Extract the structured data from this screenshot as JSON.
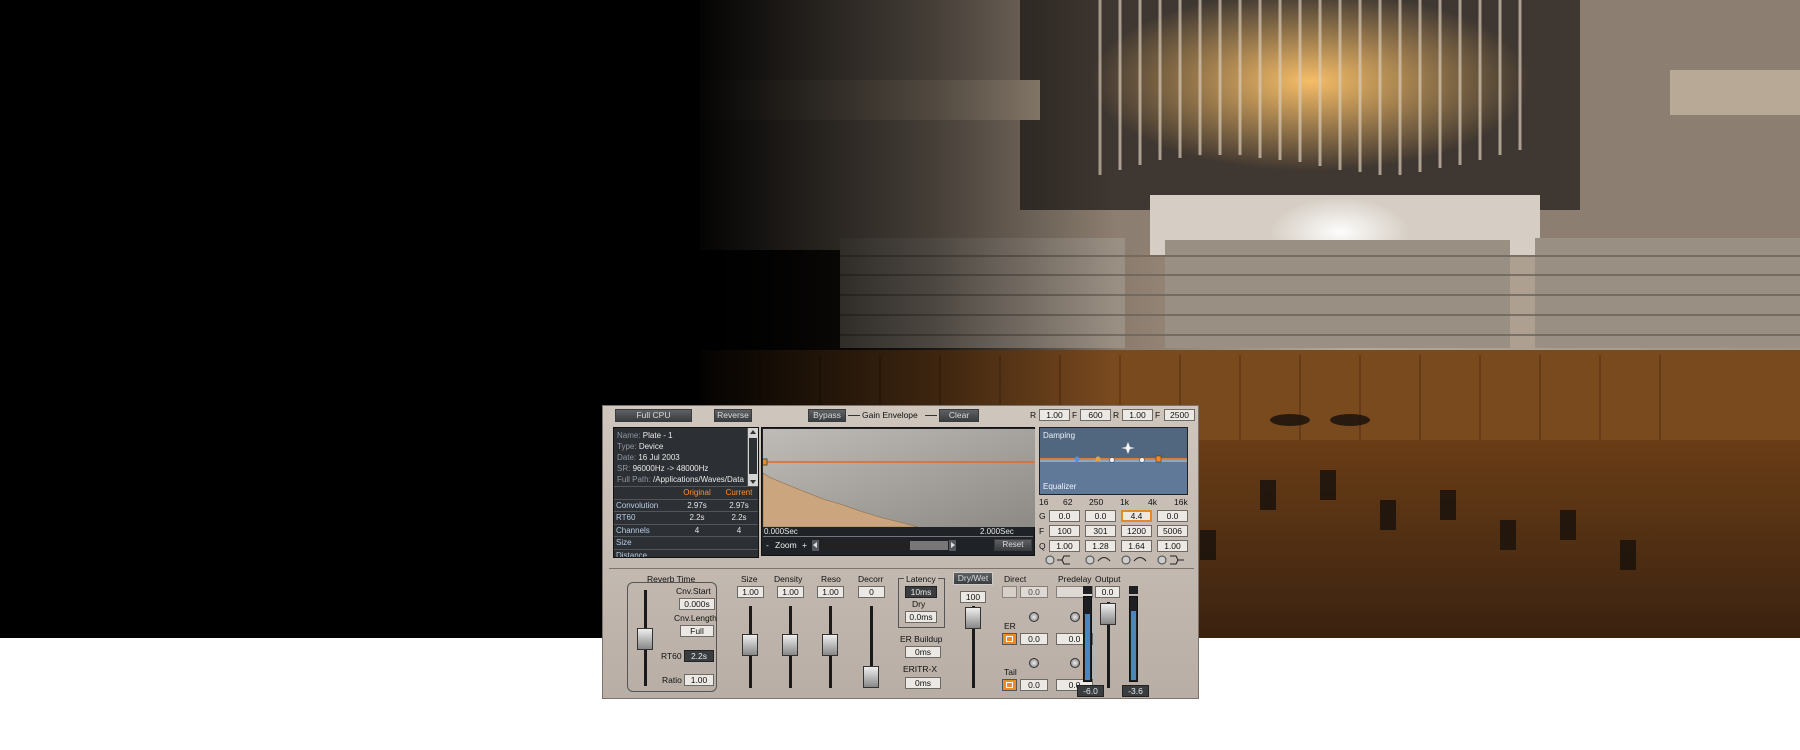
{
  "plugin": {
    "top_bar": {
      "full_cpu": "Full CPU",
      "reverse": "Reverse",
      "bypass": "Bypass",
      "gain_envelope": "Gain Envelope",
      "clear": "Clear",
      "r1_label": "R",
      "r1_value": "1.00",
      "f1_label": "F",
      "f1_value": "600",
      "r2_label": "R",
      "r2_value": "1.00",
      "f2_label": "F",
      "f2_value": "2500"
    },
    "info": {
      "name_key": "Name:",
      "name_val": "Plate - 1",
      "type_key": "Type:",
      "type_val": "Device",
      "date_key": "Date:",
      "date_val": "16 Jul 2003",
      "sr_key": "SR:",
      "sr_val": "96000Hz -> 48000Hz",
      "path_key": "Full Path:",
      "path_val": "/Applications/Waves/Data",
      "col_original": "Original",
      "col_current": "Current",
      "rows": [
        {
          "name": "Convolution",
          "original": "2.97s",
          "current": "2.97s"
        },
        {
          "name": "RT60",
          "original": "2.2s",
          "current": "2.2s"
        },
        {
          "name": "Channels",
          "original": "4",
          "current": "4"
        },
        {
          "name": "Size",
          "original": "",
          "current": ""
        },
        {
          "name": "Distance",
          "original": "",
          "current": ""
        }
      ]
    },
    "envelope": {
      "time_start": "0.000Sec",
      "time_end": "2.000Sec",
      "zoom_minus": "-",
      "zoom_label": "Zoom",
      "zoom_plus": "+",
      "reset": "Reset"
    },
    "eq": {
      "damping_label": "Damping",
      "equalizer_label": "Equalizer",
      "freq_ticks": [
        "16",
        "62",
        "250",
        "1k",
        "4k",
        "16k"
      ],
      "g_label": "G",
      "f_label": "F",
      "q_label": "Q",
      "g_values": [
        "0.0",
        "0.0",
        "4.4",
        "0.0"
      ],
      "f_values": [
        "100",
        "301",
        "1200",
        "5006"
      ],
      "q_values": [
        "1.00",
        "1.28",
        "1.64",
        "1.00"
      ]
    },
    "bottom": {
      "reverb_time_title": "Reverb Time",
      "cnv_start_label": "Cnv.Start",
      "cnv_start_value": "0.000s",
      "cnv_length_label": "Cnv.Length",
      "cnv_length_value": "Full",
      "rt60_label": "RT60",
      "rt60_value": "2.2s",
      "ratio_label": "Ratio",
      "ratio_value": "1.00",
      "size_label": "Size",
      "size_value": "1.00",
      "density_label": "Density",
      "density_value": "1.00",
      "reso_label": "Reso",
      "reso_value": "1.00",
      "decorr_label": "Decorr",
      "decorr_value": "0",
      "latency_label": "Latency",
      "latency_value": "10ms",
      "dry_label": "Dry",
      "dry_value": "0.0ms",
      "er_buildup_label": "ER Buildup",
      "er_buildup_value": "0ms",
      "eritr_label": "ERITR-X",
      "eritr_value": "0ms",
      "drywet_label": "Dry/Wet",
      "drywet_value": "100",
      "direct_label": "Direct",
      "direct_value": "0.0",
      "predelay_label": "Predelay",
      "er_label": "ER",
      "er_value": "0.0",
      "er_predelay_value": "0.0",
      "tail_label": "Tail",
      "tail_value": "0.0",
      "tail_predelay_value": "0.0",
      "output_label": "Output",
      "output_value": "0.0",
      "meter_left": "-6.0",
      "meter_right": "-3.6"
    }
  }
}
